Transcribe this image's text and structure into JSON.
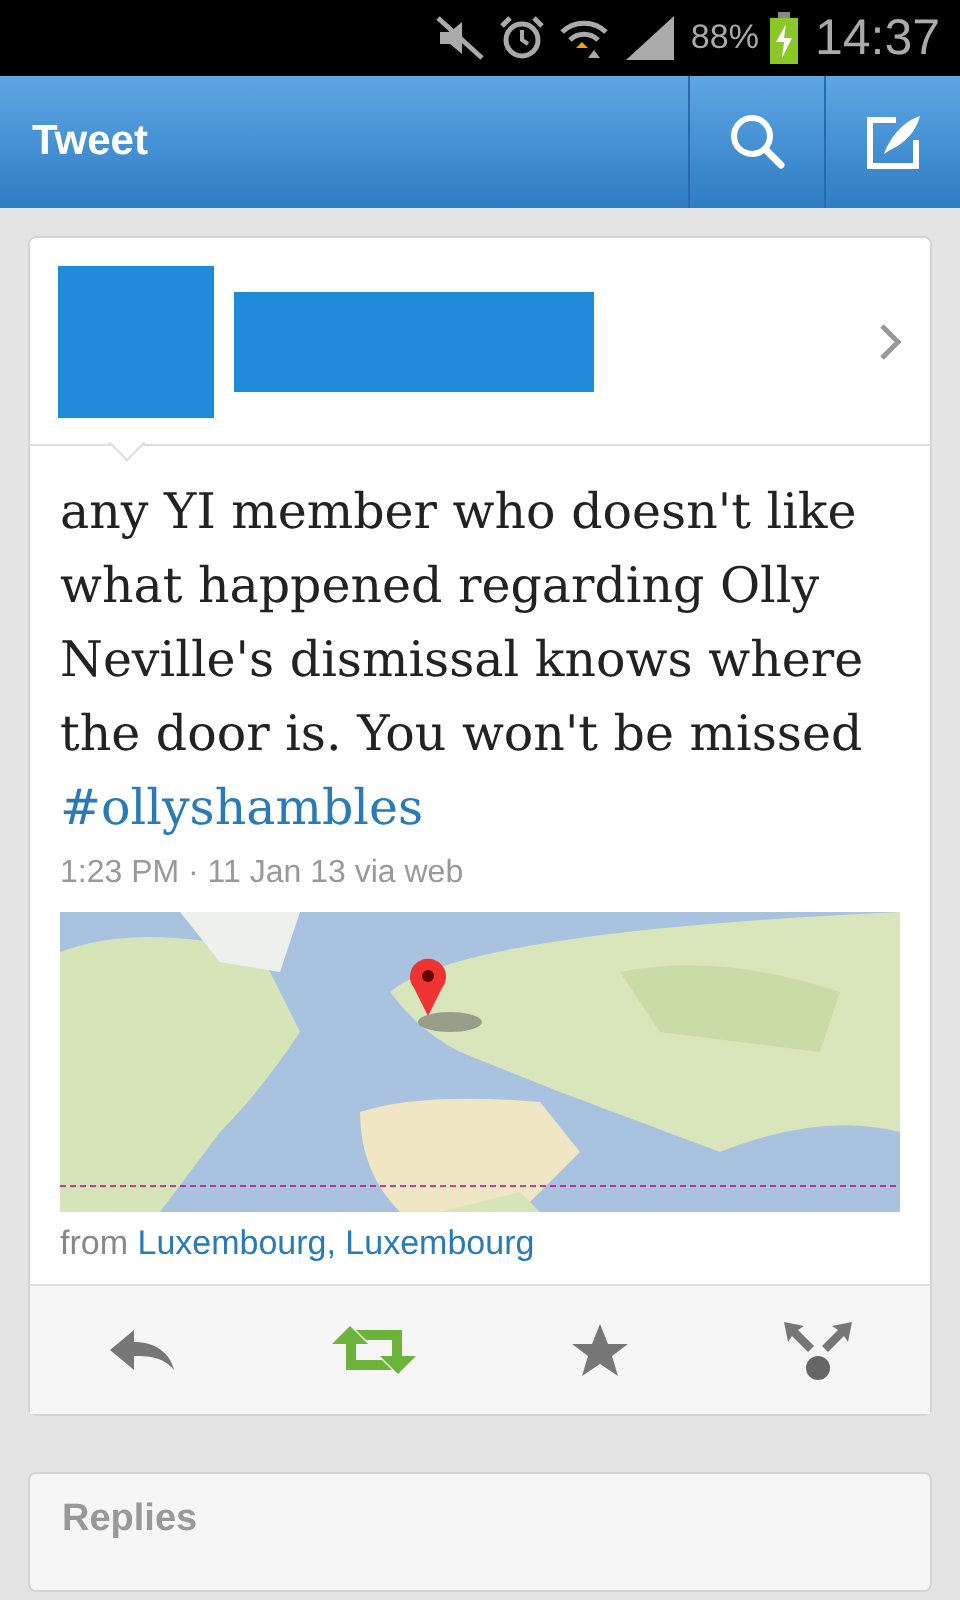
{
  "status_bar": {
    "battery": "88%",
    "time": "14:37"
  },
  "header": {
    "title": "Tweet"
  },
  "tweet": {
    "text": "any YI member who doesn't like what happened regarding Olly Neville's dismissal knows where the door is. You won't be missed",
    "hashtag": "#ollyshambles",
    "timestamp": "1:23 PM · 11 Jan 13 via web",
    "location_prefix": "from",
    "location": "Luxembourg, Luxembourg",
    "actions": [
      {
        "kind": "reply",
        "on": false
      },
      {
        "kind": "retweet",
        "on": true
      },
      {
        "kind": "favorite",
        "on": false
      },
      {
        "kind": "share",
        "on": false
      }
    ]
  },
  "replies": {
    "title": "Replies"
  }
}
